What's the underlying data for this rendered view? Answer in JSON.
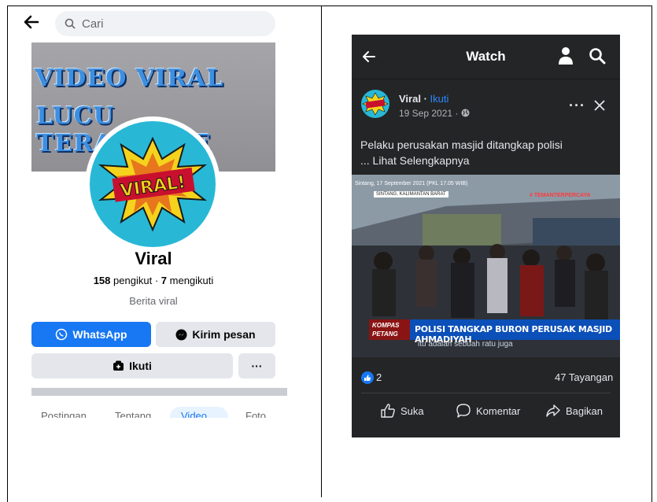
{
  "left_panel": {
    "search_placeholder": "Cari",
    "cover_line1": "VIDEO VIRAL",
    "cover_line2": "LUCU TERAPDUTE",
    "avatar_text": "VIRAL!",
    "profile_name": "Viral",
    "followers_count": "158",
    "followers_label": "pengikut",
    "stats_sep": "·",
    "following_count": "7",
    "following_label": "mengikuti",
    "bio": "Berita viral",
    "whatsapp_label": "WhatsApp",
    "message_label": "Kirim pesan",
    "follow_label": "Ikuti",
    "more_label": "···",
    "tabs": [
      "Postingan",
      "Tentang",
      "Video",
      "Foto"
    ]
  },
  "right_panel": {
    "title": "Watch",
    "page_name": "Viral",
    "name_sep": " · ",
    "follow_link": "Ikuti",
    "post_date": "19 Sep 2021 ·",
    "more_label": "···",
    "post_text_line1": "Pelaku perusakan masjid ditangkap polisi",
    "post_text_line2": "... Lihat Selengkapnya",
    "video": {
      "dateline": "Sintang, 17 September 2021 (PKL 17.05 WIB)",
      "location_tag": "SINTANG, KALIMANTAN BARAT",
      "brand": "# TEMANTERPERCAYA",
      "program_line1": "KOMPAS",
      "program_line2": "PETANG",
      "headline": "POLISI TANGKAP BURON PERUSAK MASJID AHMADIYAH",
      "subtitle": "itu adalah sebuah ratu juga"
    },
    "like_count": "2",
    "views": "47 Tayangan",
    "actions": {
      "like": "Suka",
      "comment": "Komentar",
      "share": "Bagikan"
    }
  },
  "colors": {
    "facebook_blue": "#1877f2",
    "dark_bg": "#242526",
    "link_blue": "#2d88ff",
    "button_gray": "#e4e6eb"
  }
}
